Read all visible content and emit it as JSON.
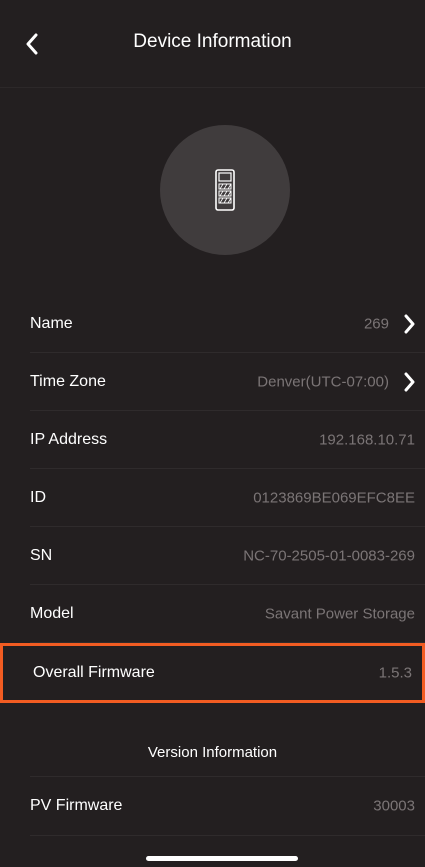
{
  "nav": {
    "title": "Device Information",
    "back_icon": "chevron-left-icon"
  },
  "device": {
    "icon": "battery-unit-icon"
  },
  "info_rows": [
    {
      "label": "Name",
      "value": "269",
      "has_chevron": true
    },
    {
      "label": "Time Zone",
      "value": "Denver(UTC-07:00)",
      "has_chevron": true
    },
    {
      "label": "IP Address",
      "value": "192.168.10.71",
      "has_chevron": false
    },
    {
      "label": "ID",
      "value": "0123869BE069EFC8EE",
      "has_chevron": false
    },
    {
      "label": "SN",
      "value": "NC-70-2505-01-0083-269",
      "has_chevron": false
    },
    {
      "label": "Model",
      "value": "Savant Power Storage",
      "has_chevron": false
    },
    {
      "label": "Overall Firmware",
      "value": "1.5.3",
      "has_chevron": false
    }
  ],
  "version_section": {
    "title": "Version Information",
    "rows": [
      {
        "label": "PV Firmware",
        "value": "30003"
      }
    ]
  },
  "colors": {
    "background": "#231f20",
    "avatar": "#403c3d",
    "value_text": "#7b7576",
    "highlight_border": "#f25c22"
  }
}
